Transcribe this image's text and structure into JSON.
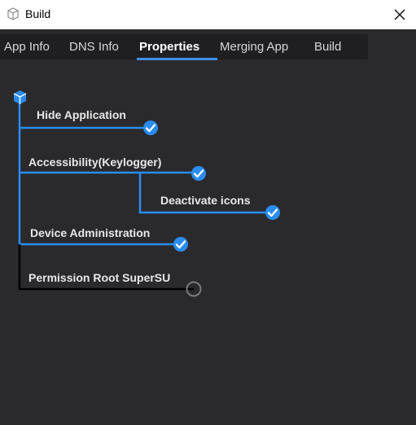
{
  "window": {
    "title": "Build"
  },
  "tabs": [
    {
      "label": "App Info",
      "active": false
    },
    {
      "label": "DNS Info",
      "active": false
    },
    {
      "label": "Properties",
      "active": true
    },
    {
      "label": "Merging App",
      "active": false
    },
    {
      "label": "Build",
      "active": false
    }
  ],
  "tree": {
    "nodes": [
      {
        "label": "Hide Application",
        "checked": true
      },
      {
        "label": "Accessibility(Keylogger)",
        "checked": true
      },
      {
        "label": "Deactivate icons",
        "checked": true
      },
      {
        "label": "Device Administration",
        "checked": true
      },
      {
        "label": "Permission Root SuperSU",
        "checked": false
      }
    ]
  },
  "colors": {
    "accent": "#2a8cf0",
    "tree_line_active": "#2a8cf0",
    "tree_line_inactive": "#000000",
    "background": "#2a2a2d",
    "tabbar": "#1f1f21"
  }
}
